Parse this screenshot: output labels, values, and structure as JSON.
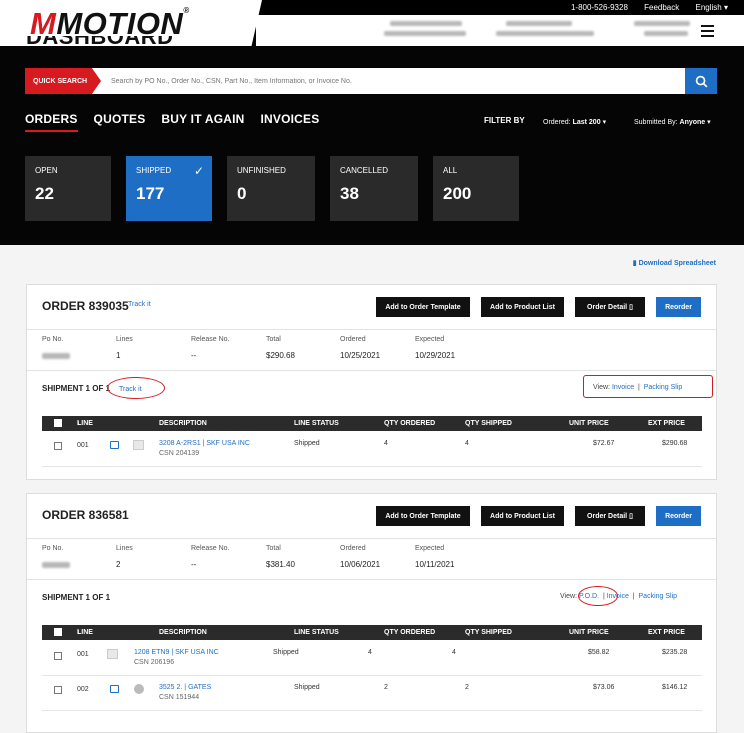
{
  "brand": {
    "logo_prefix": "M",
    "logo_text": "MOTION",
    "reg": "®"
  },
  "util": {
    "phone": "1-800-526-9328",
    "feedback": "Feedback",
    "language": "English"
  },
  "page_title": "DASHBOARD",
  "search": {
    "label": "QUICK SEARCH",
    "placeholder": "Search by PO No., Order No., CSN, Part No., Item Information, or Invoice No."
  },
  "tabs": [
    {
      "label": "ORDERS",
      "active": true
    },
    {
      "label": "QUOTES"
    },
    {
      "label": "BUY IT AGAIN"
    },
    {
      "label": "INVOICES"
    }
  ],
  "filter": {
    "label": "FILTER BY",
    "ordered_key": "Ordered:",
    "ordered_val": "Last 200",
    "submitted_key": "Submitted By:",
    "submitted_val": "Anyone"
  },
  "cards": [
    {
      "label": "OPEN",
      "count": "22"
    },
    {
      "label": "SHIPPED",
      "count": "177",
      "selected": true
    },
    {
      "label": "UNFINISHED",
      "count": "0"
    },
    {
      "label": "CANCELLED",
      "count": "38"
    },
    {
      "label": "ALL",
      "count": "200"
    }
  ],
  "download": "Download Spreadsheet",
  "buttons": {
    "template": "Add to Order Template",
    "product_list": "Add to Product List",
    "detail": "Order Detail",
    "reorder": "Reorder"
  },
  "meta_keys": {
    "po": "Po No.",
    "lines": "Lines",
    "release": "Release No.",
    "total": "Total",
    "ordered": "Ordered",
    "expected": "Expected"
  },
  "columns": {
    "line": "LINE",
    "description": "DESCRIPTION",
    "status": "LINE STATUS",
    "qty_ordered": "QTY ORDERED",
    "qty_shipped": "QTY SHIPPED",
    "unit_price": "UNIT PRICE",
    "ext_price": "EXT PRICE"
  },
  "orders": [
    {
      "title": "ORDER 839035",
      "track": "Track it",
      "lines": "1",
      "release": "--",
      "total": "$290.68",
      "ordered": "10/25/2021",
      "expected": "10/29/2021",
      "shipment": "SHIPMENT 1 OF 1",
      "ship_track": "Track it",
      "view": "View:",
      "pod": "",
      "invoice": "Invoice",
      "packing": "Packing Slip",
      "rows": [
        {
          "line": "001",
          "desc": "3208 A-2RS1 | SKF USA INC",
          "csn": "CSN 204139",
          "status": "Shipped",
          "qo": "4",
          "qs": "4",
          "unit": "$72.67",
          "ext": "$290.68"
        }
      ]
    },
    {
      "title": "ORDER 836581",
      "track": "",
      "lines": "2",
      "release": "--",
      "total": "$381.40",
      "ordered": "10/06/2021",
      "expected": "10/11/2021",
      "shipment": "SHIPMENT 1 OF 1",
      "ship_track": "",
      "view": "View:",
      "pod": "P.O.D.",
      "invoice": "Invoice",
      "packing": "Packing Slip",
      "rows": [
        {
          "line": "001",
          "desc": "1208 ETN9 | SKF USA INC",
          "csn": "CSN 206196",
          "status": "Shipped",
          "qo": "4",
          "qs": "4",
          "unit": "$58.82",
          "ext": "$235.28"
        },
        {
          "line": "002",
          "desc": "3525 2. | GATES",
          "csn": "CSN 151944",
          "status": "Shipped",
          "qo": "2",
          "qs": "2",
          "unit": "$73.06",
          "ext": "$146.12"
        }
      ]
    }
  ]
}
